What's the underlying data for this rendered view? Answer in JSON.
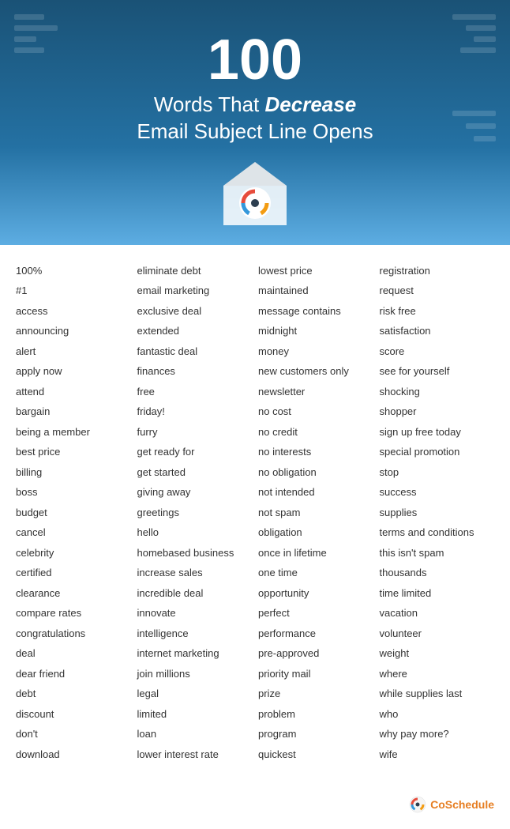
{
  "header": {
    "number": "100",
    "line1": "Words That ",
    "line1_italic": "Decrease",
    "line2": "Email Subject Line Opens"
  },
  "columns": [
    [
      "100%",
      "#1",
      "access",
      "announcing",
      "alert",
      "apply now",
      "attend",
      "bargain",
      "being a member",
      "best price",
      "billing",
      "boss",
      "budget",
      "cancel",
      "celebrity",
      "certified",
      "clearance",
      "compare rates",
      "congratulations",
      "deal",
      "dear friend",
      "debt",
      "discount",
      "don't",
      "download"
    ],
    [
      "eliminate debt",
      "email marketing",
      "exclusive deal",
      "extended",
      "fantastic deal",
      "finances",
      "free",
      "friday!",
      "furry",
      "get ready for",
      "get started",
      "giving away",
      "greetings",
      "hello",
      "homebased business",
      "increase sales",
      "incredible deal",
      "innovate",
      "intelligence",
      "internet marketing",
      "join millions",
      "legal",
      "limited",
      "loan",
      "lower interest rate"
    ],
    [
      "lowest price",
      "maintained",
      "message contains",
      "midnight",
      "money",
      "new customers only",
      "newsletter",
      "no cost",
      "no credit",
      "no interests",
      "no obligation",
      "not intended",
      "not spam",
      "obligation",
      "once in lifetime",
      "one time",
      "opportunity",
      "perfect",
      "performance",
      "pre-approved",
      "priority mail",
      "prize",
      "problem",
      "program",
      "quickest"
    ],
    [
      "registration",
      "request",
      "risk free",
      "satisfaction",
      "score",
      "see for yourself",
      "shocking",
      "shopper",
      "sign up free today",
      "special promotion",
      "stop",
      "success",
      "supplies",
      "terms and conditions",
      "this isn't spam",
      "thousands",
      "time limited",
      "vacation",
      "volunteer",
      "weight",
      "where",
      "while supplies last",
      "who",
      "why pay more?",
      "wife"
    ]
  ],
  "footer": {
    "brand": "CoSchedule"
  }
}
